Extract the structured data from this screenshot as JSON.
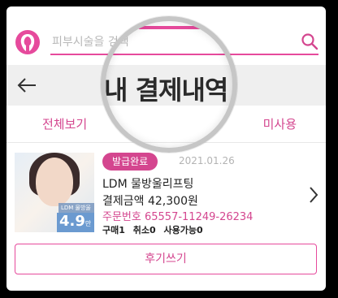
{
  "search": {
    "placeholder": "피부시술을 검색"
  },
  "header": {
    "title": "내 결제내역"
  },
  "tabs": [
    {
      "label": "전체보기"
    },
    {
      "label": "미사용"
    }
  ],
  "order": {
    "thumbnail": {
      "caption": "LDM 물방울리프팅",
      "price": "4.9",
      "unit": "만원"
    },
    "status": "발급완료",
    "date": "2021.01.26",
    "product_name": "LDM 물방울리프팅",
    "amount_label": "결제금액",
    "amount_value": "42,300원",
    "order_number_label": "주문번호",
    "order_number": "65557-11249-26234",
    "counts": {
      "purchase": "구매1",
      "cancel": "취소0",
      "usable": "사용가능0"
    },
    "review_button": "후기쓰기"
  },
  "colors": {
    "accent": "#d4468f",
    "underline": "#e64a9c",
    "header_bg": "#efefef"
  }
}
